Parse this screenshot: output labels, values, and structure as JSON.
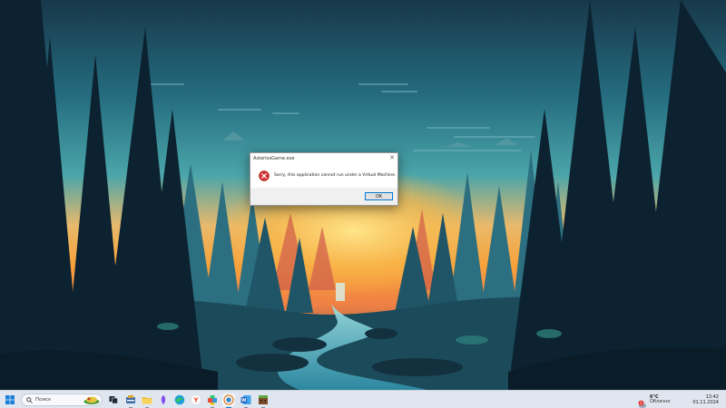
{
  "dialog": {
    "title": "AsteriosGame.exe",
    "close_glyph": "✕",
    "message": "Sorry, this application cannot run under a Virtual Machine.",
    "ok_label": "OK",
    "icon": "error-icon"
  },
  "taskbar": {
    "search_placeholder": "Поиск",
    "icons": [
      "windows-start-icon",
      "search-icon",
      "task-view-icon",
      "app-icon",
      "file-explorer-icon",
      "feather-app-icon",
      "edge-icon",
      "yandex-icon",
      "puzzle-app-icon",
      "game-app-icon",
      "word-icon",
      "blocks-app-icon"
    ],
    "weather": {
      "temp": "6°C",
      "condition": "Облачно",
      "badge": "1"
    },
    "clock": {
      "time": "13:42",
      "date": "01.11.2024"
    }
  },
  "colors": {
    "accent": "#0078d4",
    "error_red": "#d32f2f",
    "taskbar_bg": "#dfe6ef",
    "sky_top": "#1b4a5c",
    "sunset": "#f6a93b"
  }
}
